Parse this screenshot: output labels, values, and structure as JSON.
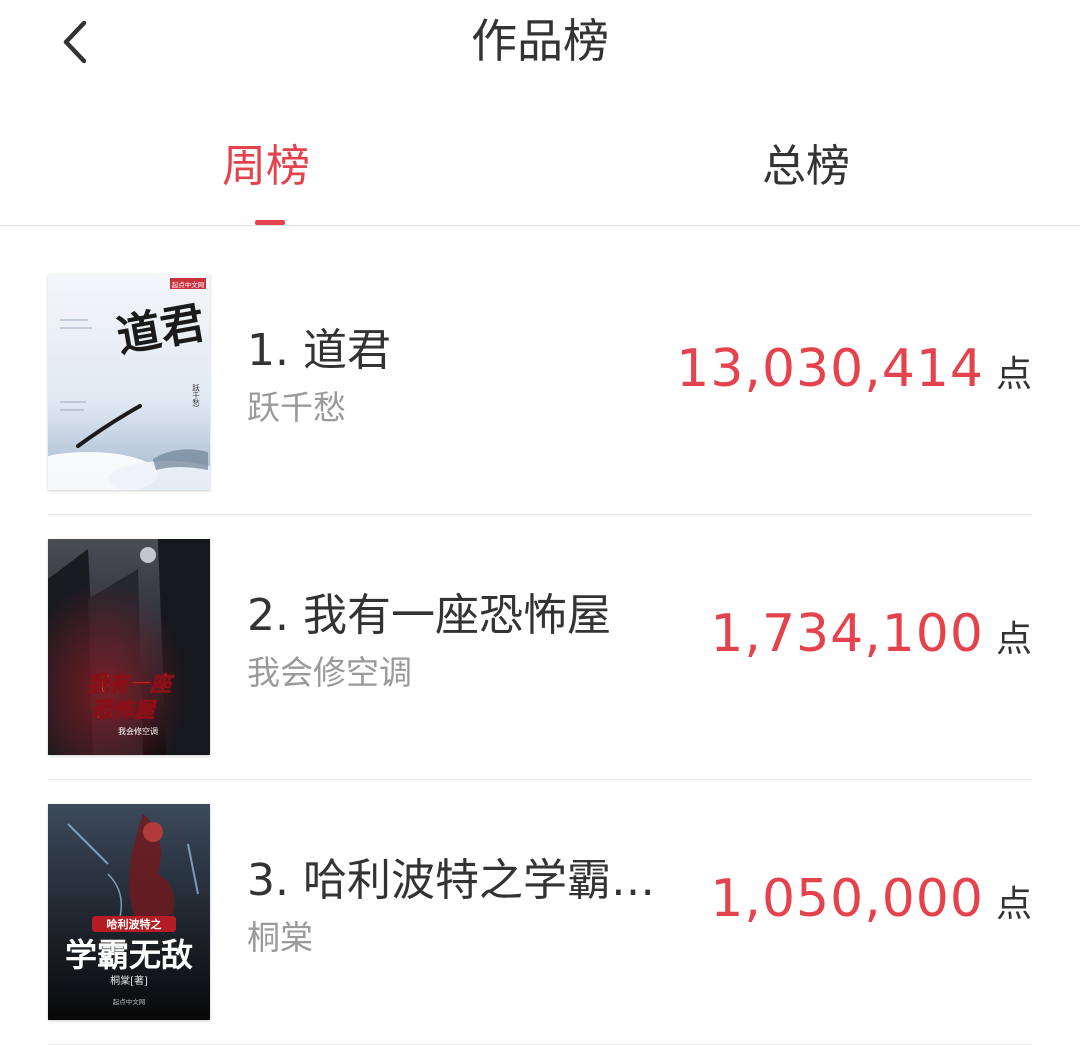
{
  "header": {
    "title": "作品榜",
    "back_icon": "chevron-left-icon"
  },
  "tabs": [
    {
      "label": "周榜",
      "active": true
    },
    {
      "label": "总榜",
      "active": false
    }
  ],
  "colors": {
    "accent": "#e4434d",
    "text_primary": "#333333",
    "text_secondary": "#9a9a9a",
    "divider": "#e3e3e3"
  },
  "rankings": [
    {
      "title": "1. 道君",
      "author": "跃千愁",
      "score": "13,030,414",
      "unit": "点",
      "cover": {
        "title": "道君",
        "author": "跃千愁",
        "publisher": "起点中文网"
      }
    },
    {
      "title": "2. 我有一座恐怖屋",
      "author": "我会修空调",
      "score": "1,734,100",
      "unit": "点",
      "cover": {
        "title_line1": "我有一座",
        "title_line2": "恐怖屋",
        "author": "我会修空调"
      }
    },
    {
      "title": "3. 哈利波特之学霸…",
      "author": "桐棠",
      "score": "1,050,000",
      "unit": "点",
      "cover": {
        "subtitle": "哈利波特之",
        "title": "学霸无敌",
        "author": "桐棠[著]",
        "publisher": "起点中文网"
      }
    }
  ]
}
